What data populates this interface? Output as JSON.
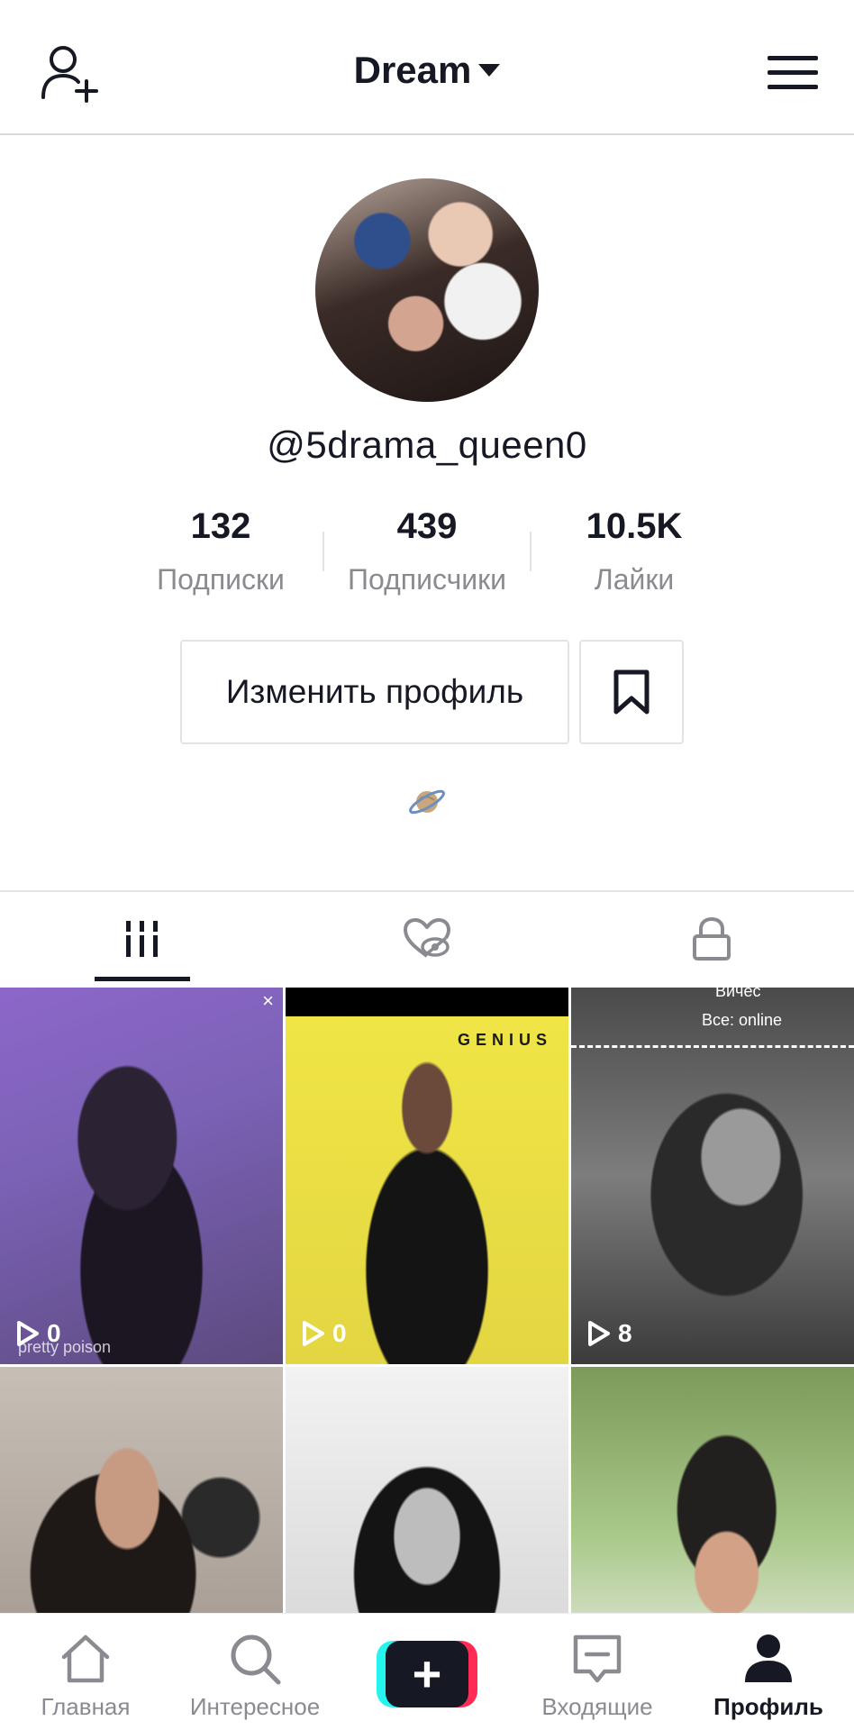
{
  "header": {
    "title": "Dream",
    "add_friend_icon": "person-add-icon",
    "menu_icon": "hamburger-menu-icon"
  },
  "profile": {
    "username": "@5drama_queen0",
    "stats": [
      {
        "value": "132",
        "label": "Подписки"
      },
      {
        "value": "439",
        "label": "Подписчики"
      },
      {
        "value": "10.5K",
        "label": "Лайки"
      }
    ],
    "edit_button": "Изменить профиль",
    "bookmark_icon": "bookmark-icon",
    "bio_emoji": "planet-emoji"
  },
  "tabs": [
    {
      "name": "videos",
      "icon": "grid-lines-icon",
      "active": true
    },
    {
      "name": "liked",
      "icon": "hidden-heart-icon",
      "active": false
    },
    {
      "name": "private",
      "icon": "lock-icon",
      "active": false
    }
  ],
  "videos": [
    {
      "views": "0",
      "caption": "pretty poison",
      "close": "×"
    },
    {
      "views": "0",
      "tag": "GENIUS"
    },
    {
      "views": "8",
      "top_name": "Вичес",
      "status": "Все: online"
    },
    {
      "views": ""
    },
    {
      "views": ""
    },
    {
      "views": ""
    }
  ],
  "bottom_nav": [
    {
      "label": "Главная",
      "icon": "home-icon"
    },
    {
      "label": "Интересное",
      "icon": "search-icon"
    },
    {
      "label": "",
      "icon": "plus-icon"
    },
    {
      "label": "Входящие",
      "icon": "inbox-icon"
    },
    {
      "label": "Профиль",
      "icon": "profile-icon",
      "active": true
    }
  ],
  "colors": {
    "accent_cyan": "#25f4ee",
    "accent_red": "#fe2c55",
    "text_primary": "#161823",
    "text_secondary": "#8a8b91"
  }
}
